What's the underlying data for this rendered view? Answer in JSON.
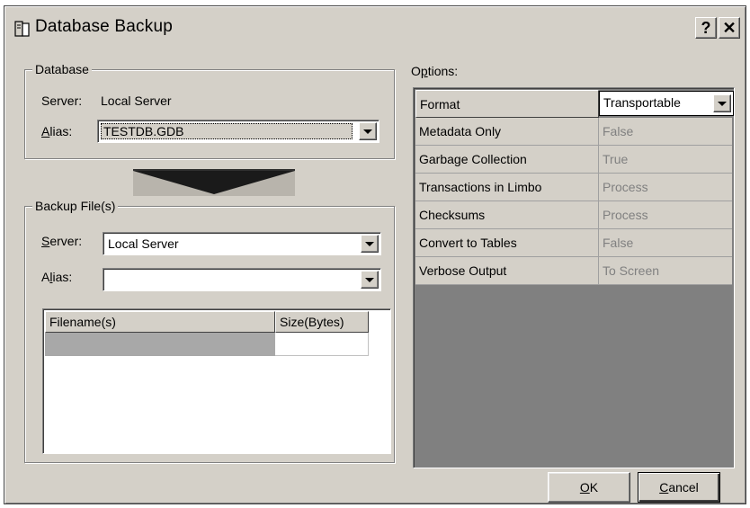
{
  "window": {
    "title": "Database Backup",
    "help_label": "?",
    "close_label": "✕"
  },
  "database_group": {
    "legend": "Database",
    "server_label": "Server:",
    "server_value": "Local Server",
    "alias_label_pre": "",
    "alias_label_ul": "A",
    "alias_label_post": "lias:",
    "alias_value": "TESTDB.GDB"
  },
  "backup_group": {
    "legend": "Backup File(s)",
    "server_label_ul": "S",
    "server_label_post": "erver:",
    "server_value": "Local Server",
    "alias_label_pre": "A",
    "alias_label_ul": "l",
    "alias_label_post": "ias:",
    "alias_value": "",
    "table": {
      "columns": [
        "Filename(s)",
        "Size(Bytes)"
      ],
      "rows": [
        [
          "",
          ""
        ]
      ]
    }
  },
  "options": {
    "label_pre": "O",
    "label_ul": "p",
    "label_post": "tions:",
    "rows": [
      {
        "name": "Format",
        "value": "Transportable"
      },
      {
        "name": "Metadata Only",
        "value": "False"
      },
      {
        "name": "Garbage Collection",
        "value": "True"
      },
      {
        "name": "Transactions in Limbo",
        "value": "Process"
      },
      {
        "name": "Checksums",
        "value": "Process"
      },
      {
        "name": "Convert to Tables",
        "value": "False"
      },
      {
        "name": "Verbose Output",
        "value": "To Screen"
      }
    ]
  },
  "buttons": {
    "ok_ul": "O",
    "ok_post": "K",
    "cancel_ul": "C",
    "cancel_post": "ancel"
  }
}
